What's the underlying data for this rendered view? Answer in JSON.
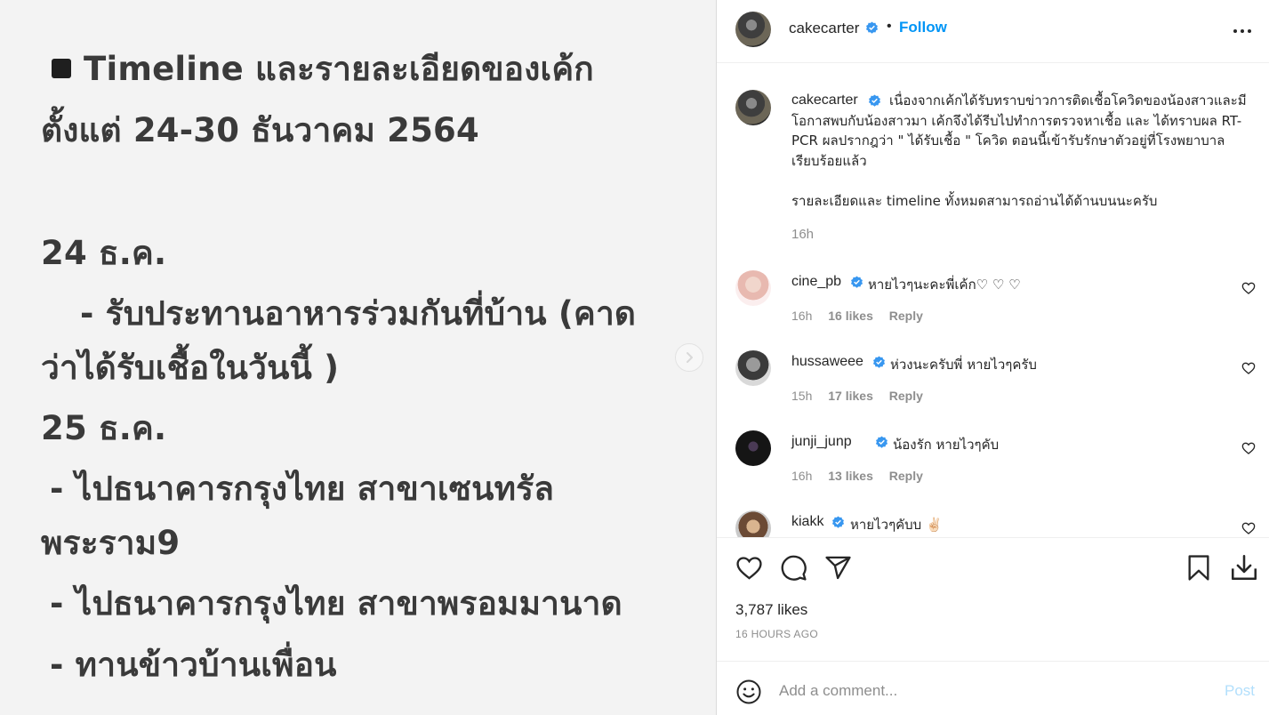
{
  "image_text": {
    "title_line1": "Timeline และรายละเอียดของเค้ก",
    "title_line2": "ตั้งแต่ 24-30 ธันวาคม 2564",
    "day1": "24 ธ.ค.",
    "day1_item1_a": "- รับประทานอาหารร่วมกันที่บ้าน (คาด",
    "day1_item1_b": "ว่าได้รับเชื้อในวันนี้ )",
    "day2": "25 ธ.ค.",
    "day2_item1_a": "- ไปธนาคารกรุงไทย สาขาเซนทรัล",
    "day2_item1_b": "พระราม9",
    "day2_item2": "- ไปธนาคารกรุงไทย สาขาพรอมมานาด",
    "day2_item3": "- ทานข้าวบ้านเพื่อน"
  },
  "header": {
    "username": "cakecarter",
    "dot": "•",
    "follow_label": "Follow"
  },
  "caption": {
    "username": "cakecarter",
    "text": "เนื่องจากเค้กได้รับทราบข่าวการติดเชื้อโควิดของน้องสาวและมีโอกาสพบกับน้องสาวมา เค้กจึงได้รีบไปทำการตรวจหาเชื้อ และ ได้ทราบผล RT-PCR ผลปรากฎว่า \" ได้รับเชื้อ \" โควิด ตอนนี้เข้ารับรักษาตัวอยู่ที่โรงพยาบาลเรียบร้อยแล้ว",
    "text2": "รายละเอียดและ timeline ทั้งหมดสามารถอ่านได้ด้านบนนะครับ",
    "time": "16h"
  },
  "comments": [
    {
      "username": "cine_pb",
      "text": "หายไวๆนะคะพี่เค้ก♡ ♡ ♡",
      "time": "16h",
      "likes": "16 likes",
      "reply": "Reply"
    },
    {
      "username": "hussaweee",
      "text": "ห่วงนะครับพี่ หายไวๆครับ",
      "time": "15h",
      "likes": "17 likes",
      "reply": "Reply"
    },
    {
      "username": "junji_junp",
      "text": "น้องรัก หายไวๆคับ",
      "time": "16h",
      "likes": "13 likes",
      "reply": "Reply"
    },
    {
      "username": "kiakk",
      "text": "หายไวๆคับบ ✌🏻",
      "time": "",
      "likes": "",
      "reply": ""
    }
  ],
  "post": {
    "likes": "3,787 likes",
    "ago": "16 HOURS AGO"
  },
  "add_comment": {
    "placeholder": "Add a comment...",
    "post_label": "Post"
  },
  "colors": {
    "accent": "#0095f6",
    "verified": "#3897f0",
    "muted": "#8e8e8e"
  },
  "icons": [
    "square-bullet-icon",
    "chevron-right-icon",
    "verified-icon",
    "more-icon",
    "heart-icon",
    "comment-icon",
    "share-icon",
    "bookmark-icon",
    "download-icon",
    "emoji-icon"
  ]
}
